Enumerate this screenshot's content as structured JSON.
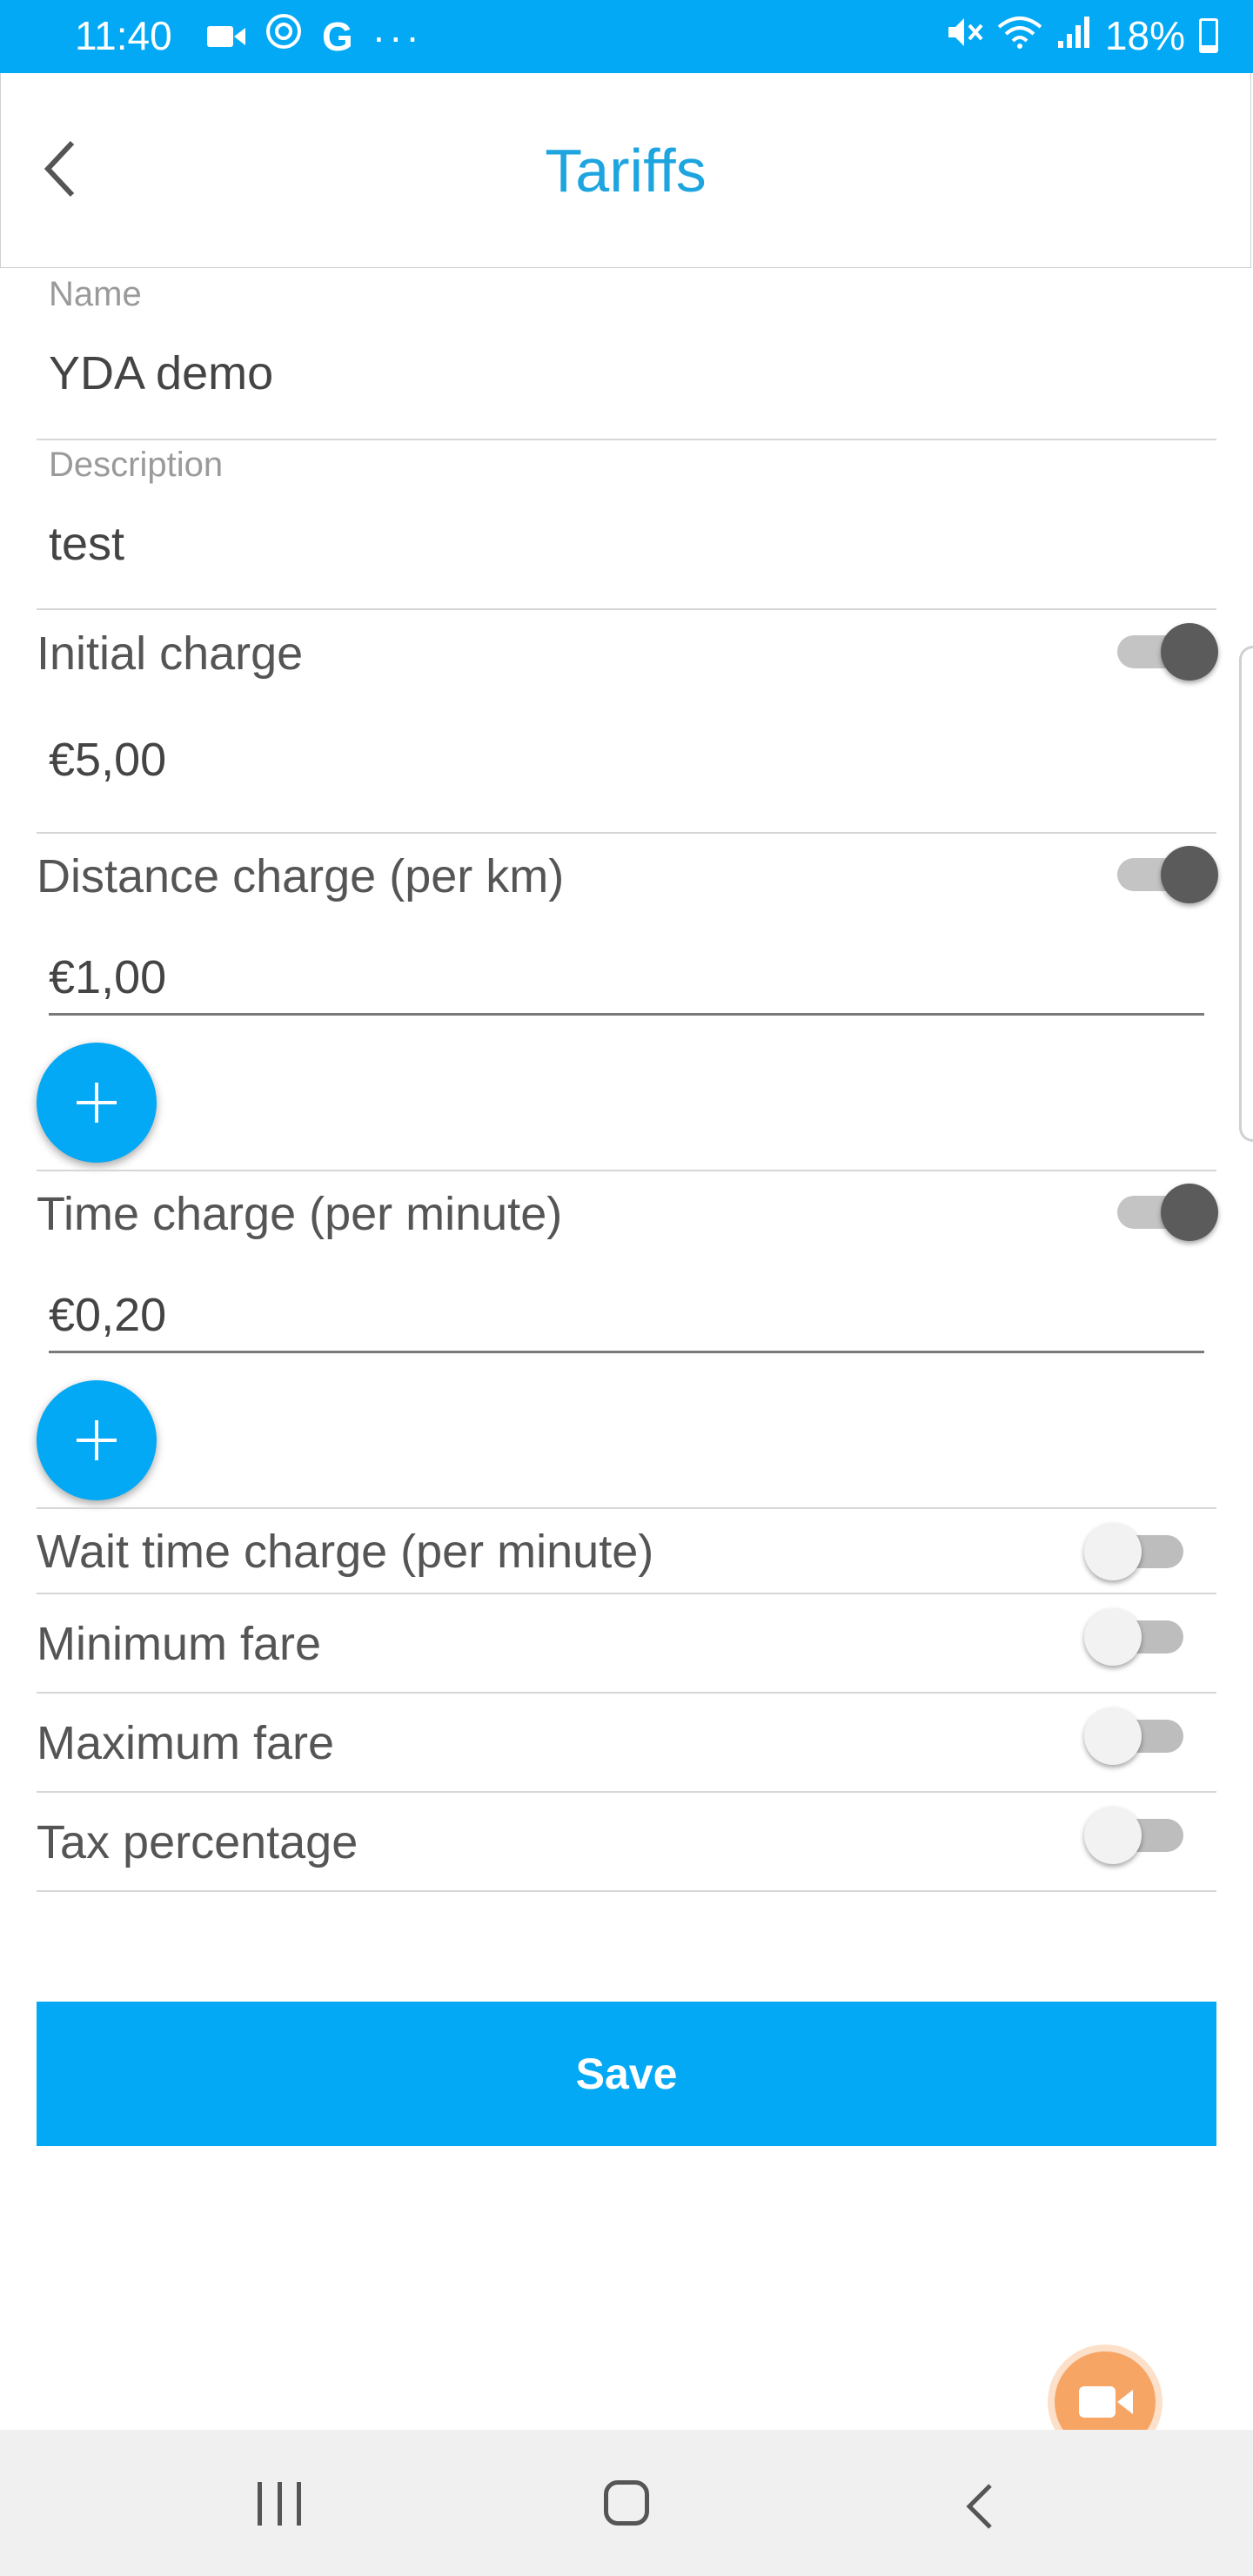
{
  "status_bar": {
    "time": "11:40",
    "icons_left": [
      "video-icon",
      "target-icon",
      "google-icon",
      "more-icon"
    ],
    "battery": "18%",
    "icons_right": [
      "mute-icon",
      "wifi-icon",
      "signal-icon",
      "battery-icon"
    ]
  },
  "header": {
    "title": "Tariffs"
  },
  "form": {
    "name": {
      "label": "Name",
      "value": "YDA demo"
    },
    "description": {
      "label": "Description",
      "value": "test"
    },
    "initial_charge": {
      "label": "Initial charge",
      "value": "€5,00",
      "enabled": true
    },
    "distance_charge": {
      "label": "Distance charge (per km)",
      "value": "€1,00",
      "enabled": true
    },
    "time_charge": {
      "label": "Time charge (per minute)",
      "value": "€0,20",
      "enabled": true
    },
    "wait_time_charge": {
      "label": "Wait time charge (per minute)",
      "enabled": false
    },
    "minimum_fare": {
      "label": "Minimum fare",
      "enabled": false
    },
    "maximum_fare": {
      "label": "Maximum fare",
      "enabled": false
    },
    "tax_percentage": {
      "label": "Tax percentage",
      "enabled": false
    }
  },
  "actions": {
    "save_label": "Save"
  },
  "colors": {
    "accent": "#03a9f4",
    "title": "#1ea5e0",
    "toggle_on": "#5b5b5b",
    "video_fab": "#f6a565"
  }
}
